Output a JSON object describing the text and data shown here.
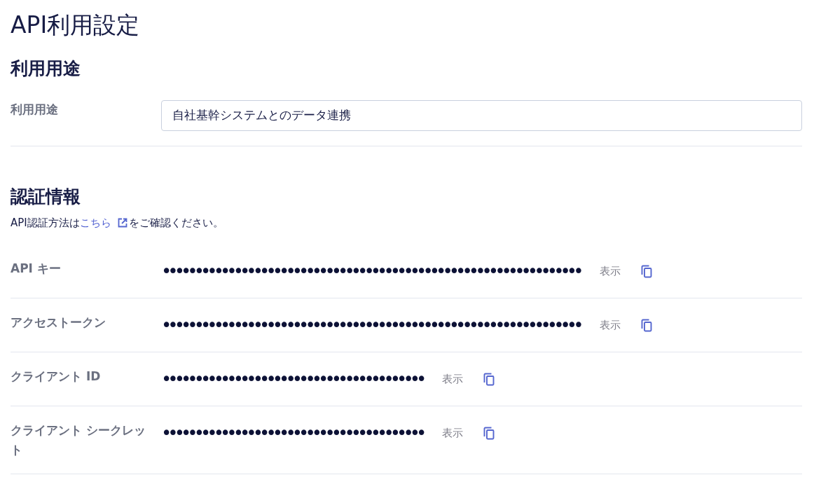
{
  "page": {
    "title": "API利用設定"
  },
  "usage_section": {
    "heading": "利用用途",
    "field": {
      "label": "利用用途",
      "value": "自社基幹システムとのデータ連携"
    }
  },
  "auth_section": {
    "heading": "認証情報",
    "note": {
      "before": "API認証方法は",
      "link": "こちら",
      "after": "をご確認ください。"
    },
    "credentials": [
      {
        "label": "API キー",
        "masked_value": "••••••••••••••••••••••••••••••••••••••••••••••••••••••••••••••••",
        "show_button": "表示"
      },
      {
        "label": "アクセストークン",
        "masked_value": "••••••••••••••••••••••••••••••••••••••••••••••••••••••••••••••••",
        "show_button": "表示"
      },
      {
        "label": "クライアント ID",
        "masked_value": "••••••••••••••••••••••••••••••••••••••••",
        "show_button": "表示"
      },
      {
        "label": "クライアント シークレット",
        "masked_value": "••••••••••••••••••••••••••••••••••••••••",
        "show_button": "表示"
      }
    ]
  }
}
